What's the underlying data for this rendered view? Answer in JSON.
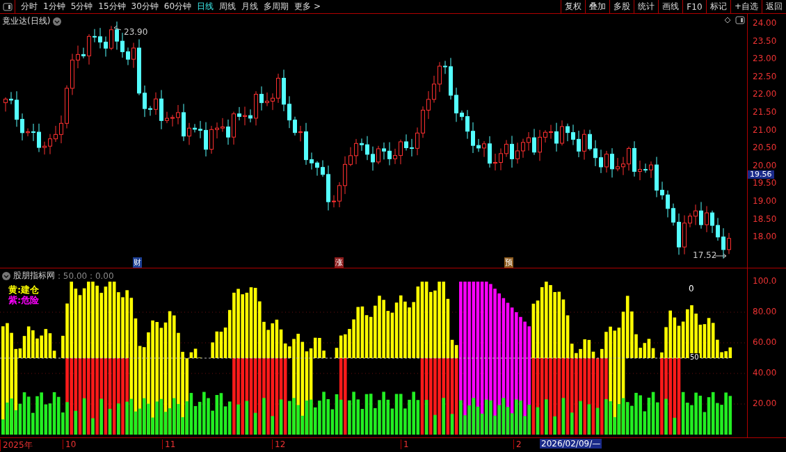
{
  "toolbar": {
    "periods": [
      {
        "label": "分时",
        "selected": false
      },
      {
        "label": "1分钟",
        "selected": false
      },
      {
        "label": "5分钟",
        "selected": false
      },
      {
        "label": "15分钟",
        "selected": false
      },
      {
        "label": "30分钟",
        "selected": false
      },
      {
        "label": "60分钟",
        "selected": false
      },
      {
        "label": "日线",
        "selected": true
      },
      {
        "label": "周线",
        "selected": false
      },
      {
        "label": "月线",
        "selected": false
      },
      {
        "label": "多周期",
        "selected": false
      },
      {
        "label": "更多 >",
        "selected": false
      }
    ],
    "buttons": [
      "复权",
      "叠加",
      "多股",
      "统计",
      "画线",
      "F10",
      "标记",
      "+自选",
      "返回"
    ]
  },
  "main_chart": {
    "title": "竟业达(日线)",
    "high_label": "23.90",
    "low_label": "17.52",
    "price_ticks": [
      "24.00",
      "23.50",
      "23.00",
      "22.50",
      "22.00",
      "21.50",
      "21.00",
      "20.50",
      "20.00",
      "19.50",
      "19.00",
      "18.50",
      "18.00"
    ],
    "current_price": "19.56",
    "event_markers": [
      {
        "label": "财",
        "color": "#1c3f94"
      },
      {
        "label": "涨",
        "color": "#8c1c1c"
      },
      {
        "label": "预",
        "color": "#8c5a1c"
      }
    ]
  },
  "indicator": {
    "name": "股朋指标网",
    "params": ": 50.00 : 0.00",
    "legend": [
      {
        "label": "黄:建仓",
        "color": "#ffff00"
      },
      {
        "label": "紫:危险",
        "color": "#ff00ff"
      }
    ],
    "value_label": "0",
    "midline_label": "50",
    "ticks": [
      "100.0",
      "80.00",
      "60.00",
      "40.00",
      "20.00"
    ]
  },
  "date_axis": {
    "labels": [
      "2025年",
      "10",
      "11",
      "12",
      "1",
      "2"
    ],
    "cursor_date": "2026/02/09/—"
  }
}
